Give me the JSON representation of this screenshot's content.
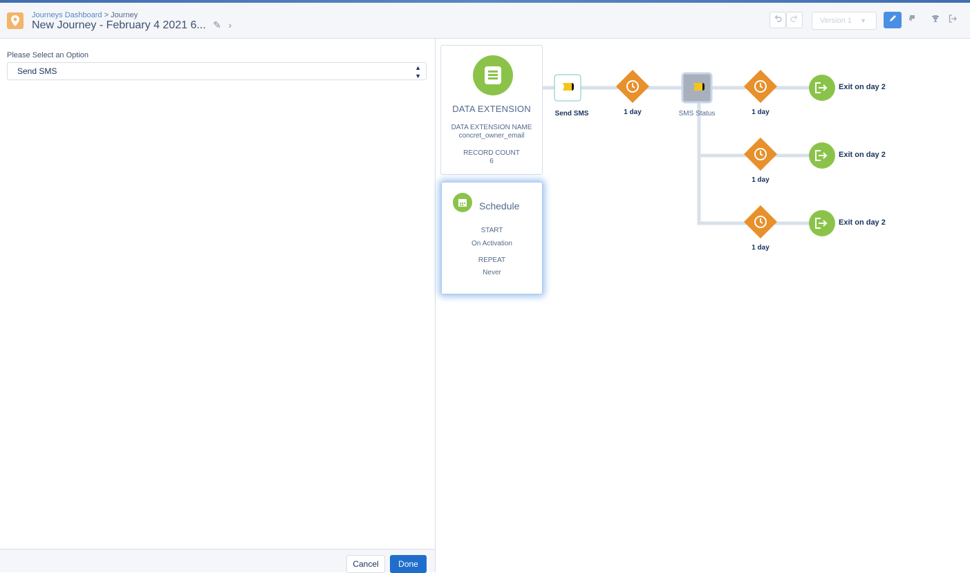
{
  "header": {
    "breadcrumb_link": "Journeys Dashboard",
    "breadcrumb_sep": " > ",
    "breadcrumb_current": "Journey",
    "title": "New Journey - February 4 2021 6...",
    "version_select": "Version 1",
    "icons": [
      "location-pin-icon",
      "undo-icon",
      "redo-icon",
      "edit-icon",
      "messages-icon",
      "trophy-icon",
      "exit-icon"
    ]
  },
  "left_panel": {
    "select_label": "Please Select an Option",
    "select_value": "Send SMS",
    "cancel_label": "Cancel",
    "done_label": "Done"
  },
  "entry_source": {
    "title": "DATA EXTENSION",
    "name_label": "DATA EXTENSION NAME",
    "name_value": "concret_owner_email",
    "count_label": "RECORD COUNT",
    "count_value": "6"
  },
  "schedule": {
    "title": "Schedule",
    "start_label": "START",
    "start_value": "On Activation",
    "repeat_label": "REPEAT",
    "repeat_value": "Never"
  },
  "canvas": {
    "send_sms": "Send SMS",
    "wait_1": "1 day",
    "sms_status": "SMS Status",
    "wait_2": "1 day",
    "wait_3": "1 day",
    "wait_4": "1 day",
    "exit_1": "Exit on day 2",
    "exit_2": "Exit on day 2",
    "exit_3": "Exit on day 2"
  },
  "colors": {
    "accent_blue": "#4a90e2",
    "done_blue": "#1f6ecc",
    "wait_orange": "#e8902b",
    "green": "#8bc34a",
    "sms_yellow": "#f5c518",
    "path_line": "#d8e0ea"
  }
}
